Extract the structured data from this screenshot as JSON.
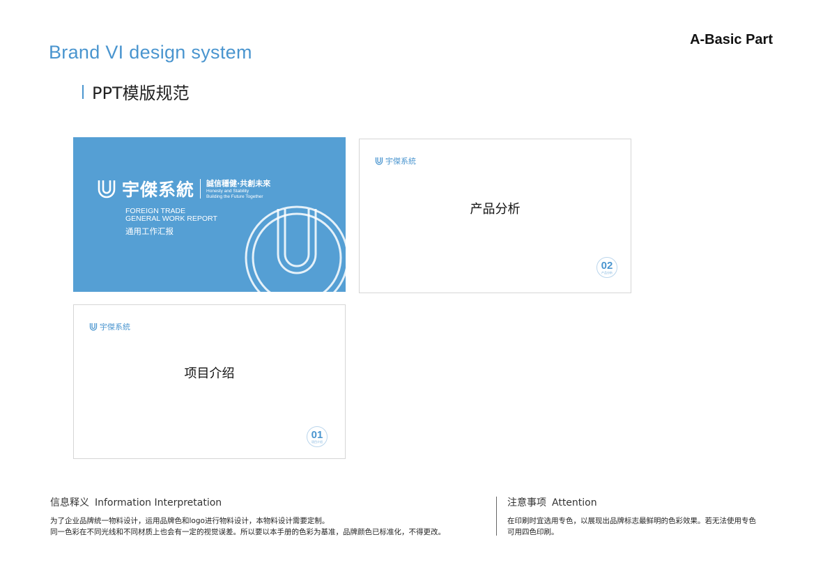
{
  "header": {
    "brand_title": "Brand VI design system",
    "part_label": "A-Basic Part",
    "section_title": "PPT模版规范"
  },
  "cover_slide": {
    "brand_name": "宇傑系統",
    "slogan_cn": "誠信穩健·共創未來",
    "slogan_en_1": "Honesty and Stability",
    "slogan_en_2": "Building the Future Together",
    "report_line_1": "FOREIGN TRADE",
    "report_line_2": "GENERAL WORK REPORT",
    "report_cn": "通用工作汇报",
    "background_color": "#559fd4"
  },
  "slides": {
    "product": {
      "logo_text": "宇傑系統",
      "title": "产品分析",
      "page_number": "02"
    },
    "project": {
      "logo_text": "宇傑系統",
      "title": "项目介绍",
      "page_number": "01"
    }
  },
  "footer": {
    "info": {
      "heading_cn": "信息释义",
      "heading_en": "Information Interpretation",
      "line_1": "为了企业品牌统一物料设计，运用品牌色和logo进行物料设计，本物料设计需要定制。",
      "line_2": "同一色彩在不同光线和不同材质上也会有一定的视觉误差。所以要以本手册的色彩为基准，品牌颜色已标准化，不得更改。"
    },
    "attention": {
      "heading_cn": "注意事项",
      "heading_en": "Attention",
      "line_1": "在印刷时宜选用专色，以展现出品牌标志最鲜明的色彩效果。若无法使用专色",
      "line_2": "可用四色印刷。"
    }
  },
  "colors": {
    "brand_blue": "#4a95cf"
  },
  "icons": {
    "logo": "u-logo-icon"
  }
}
